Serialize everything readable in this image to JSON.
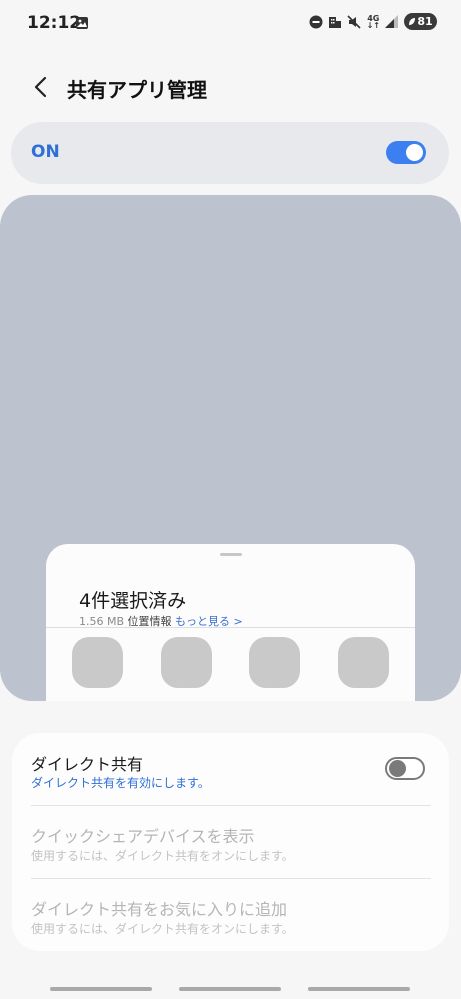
{
  "status_bar": {
    "time": "12:12",
    "network": "4G",
    "battery_level": "81"
  },
  "header": {
    "back_icon": "chevron-left-icon",
    "title": "共有アプリ管理"
  },
  "master_switch": {
    "label": "ON",
    "enabled": true
  },
  "preview": {
    "sheet_title": "4件選択済み",
    "size": "1.56 MB",
    "location": "位置情報",
    "more_link": "もっと見る >",
    "app_icon_count": 4
  },
  "settings": {
    "direct_share": {
      "title": "ダイレクト共有",
      "subtitle": "ダイレクト共有を有効にします。",
      "enabled": false
    },
    "quick_share": {
      "title": "クイックシェアデバイスを表示",
      "subtitle": "使用するには、ダイレクト共有をオンにします。"
    },
    "add_favorite": {
      "title": "ダイレクト共有をお気に入りに追加",
      "subtitle": "使用するには、ダイレクト共有をオンにします。"
    }
  },
  "colors": {
    "accent": "#3c7ff0",
    "preview_bg": "#bcc2ce",
    "card_bg": "#e8e9ec"
  }
}
